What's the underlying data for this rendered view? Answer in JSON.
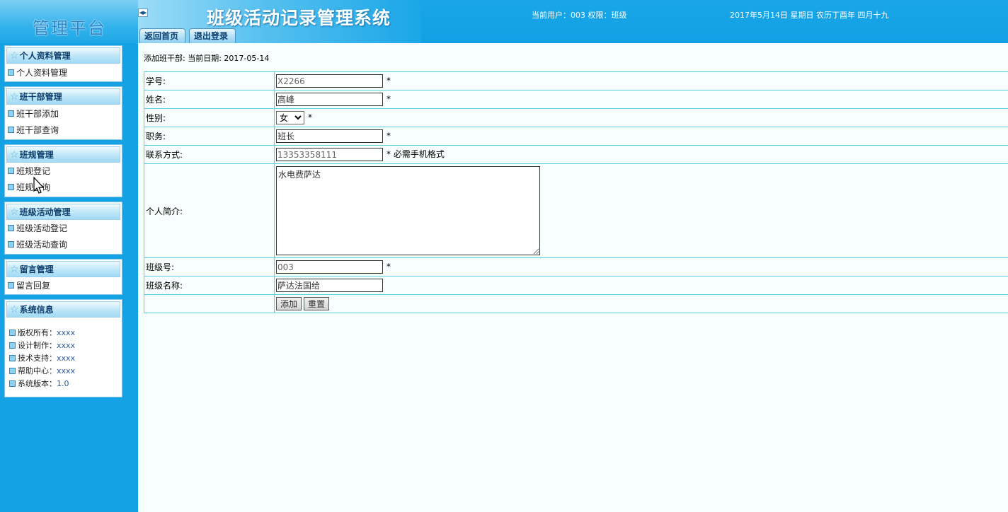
{
  "header": {
    "logo": "管理平台",
    "title": "班级活动记录管理系统",
    "buttons": {
      "home": "返回首页",
      "logout": "退出登录"
    },
    "user_info": "当前用户：003  权限：班级",
    "date_info": "2017年5月14日 星期日 农历丁酉年 四月十九"
  },
  "sidebar": {
    "panels": [
      {
        "title": "个人资料管理",
        "items": [
          "个人资料管理"
        ]
      },
      {
        "title": "班干部管理",
        "items": [
          "班干部添加",
          "班干部查询"
        ]
      },
      {
        "title": "班规管理",
        "items": [
          "班规登记",
          "班规查询"
        ]
      },
      {
        "title": "班级活动管理",
        "items": [
          "班级活动登记",
          "班级活动查询"
        ]
      },
      {
        "title": "留言管理",
        "items": [
          "留言回复"
        ]
      }
    ],
    "system_info": {
      "title": "系统信息",
      "items": [
        {
          "label": "版权所有：",
          "value": "xxxx"
        },
        {
          "label": "设计制作：",
          "value": "xxxx"
        },
        {
          "label": "技术支持：",
          "value": "xxxx"
        },
        {
          "label": "帮助中心：",
          "value": "xxxx"
        },
        {
          "label": "系统版本：",
          "value": "1.0"
        }
      ]
    }
  },
  "main": {
    "breadcrumb": "添加班干部:  当前日期:  2017-05-14",
    "form": {
      "student_id": {
        "label": "学号:",
        "value": "X2266"
      },
      "name": {
        "label": "姓名:",
        "value": "高峰"
      },
      "gender": {
        "label": "性别:",
        "value": "女"
      },
      "position": {
        "label": "职务:",
        "value": "班长"
      },
      "contact": {
        "label": "联系方式:",
        "value": "13353358111",
        "hint": "必需手机格式"
      },
      "intro": {
        "label": "个人简介:",
        "value": "水电费萨达"
      },
      "class_no": {
        "label": "班级号:",
        "value": "003"
      },
      "class_name": {
        "label": "班级名称:",
        "value": "萨达法国给"
      },
      "required_mark": "*",
      "add_button": "添加",
      "reset_button": "重置"
    }
  },
  "colors": {
    "header_bg": "#11a0e3",
    "sidebar_bg": "#14a2e4",
    "table_border": "#56d2e0",
    "main_bg": "#f6fffd"
  }
}
